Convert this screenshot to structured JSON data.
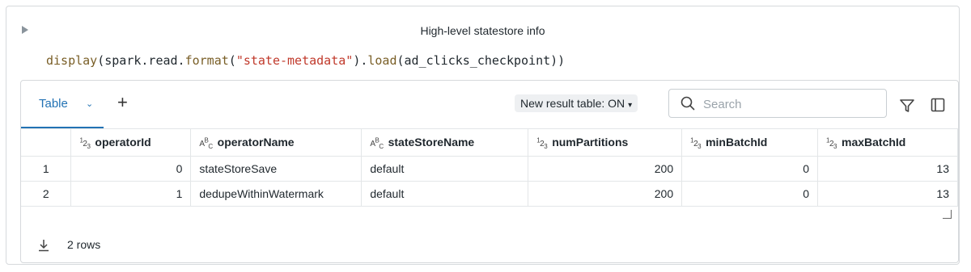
{
  "cell": {
    "title": "High-level statestore info",
    "code": {
      "fn1": "display",
      "p1": "(",
      "obj": "spark.read.",
      "fn2": "format",
      "p2": "(",
      "str": "\"state-metadata\"",
      "p3": ").",
      "fn3": "load",
      "p4": "(ad_clicks_checkpoint))"
    }
  },
  "result": {
    "tab_label": "Table",
    "toggle_label": "New result table: ON",
    "search_placeholder": "Search",
    "columns": [
      {
        "type_icon": "123",
        "name": "operatorId"
      },
      {
        "type_icon": "ABC",
        "name": "operatorName"
      },
      {
        "type_icon": "ABC",
        "name": "stateStoreName"
      },
      {
        "type_icon": "123",
        "name": "numPartitions"
      },
      {
        "type_icon": "123",
        "name": "minBatchId"
      },
      {
        "type_icon": "123",
        "name": "maxBatchId"
      }
    ],
    "rows": [
      {
        "index": "1",
        "cells": [
          "0",
          "stateStoreSave",
          "default",
          "200",
          "0",
          "13"
        ]
      },
      {
        "index": "2",
        "cells": [
          "1",
          "dedupeWithinWatermark",
          "default",
          "200",
          "0",
          "13"
        ]
      }
    ],
    "row_count": "2 rows"
  },
  "icons": {
    "collapse": "triangle-right-icon",
    "search": "search-icon",
    "filter": "filter-icon",
    "panel": "sidebar-panel-icon",
    "download": "download-icon",
    "add": "plus-icon"
  },
  "colors": {
    "accent": "#2272b4",
    "border": "#d6d9dc"
  }
}
